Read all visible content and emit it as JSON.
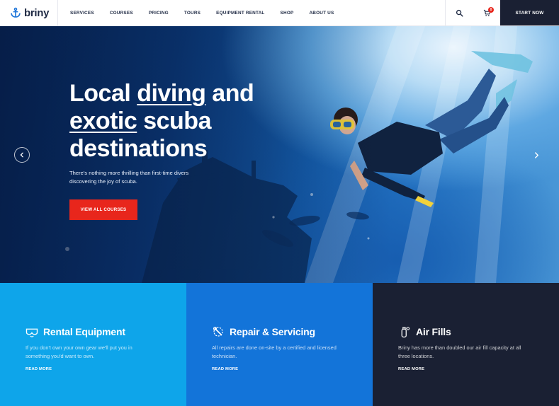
{
  "brand": {
    "name": "briny",
    "logo_icon": "anchor-icon"
  },
  "nav": {
    "items": [
      {
        "label": "SERVICES"
      },
      {
        "label": "COURSES"
      },
      {
        "label": "PRICING"
      },
      {
        "label": "TOURS"
      },
      {
        "label": "EQUIPMENT RENTAL"
      },
      {
        "label": "SHOP"
      },
      {
        "label": "ABOUT US"
      }
    ]
  },
  "header": {
    "search_icon": "search-icon",
    "cart_icon": "cart-icon",
    "cart_count": "0",
    "cta_label": "START NOW"
  },
  "hero": {
    "title_part1": "Local ",
    "title_highlight1": "diving",
    "title_part2": " and ",
    "title_highlight2": "exotic",
    "title_part3": " scuba destinations",
    "subtitle": "There's nothing more thrilling than first-time divers discovering the joy of scuba.",
    "button_label": "VIEW ALL COURSES",
    "prev_icon": "chevron-left-icon",
    "next_icon": "chevron-right-icon"
  },
  "features": [
    {
      "icon": "mask-icon",
      "title": "Rental Equipment",
      "text": "If you don't own your own gear we'll put you in something you'd want to own.",
      "link": "READ MORE",
      "color": "#0ea5ea"
    },
    {
      "icon": "wrench-icon",
      "title": "Repair & Servicing",
      "text": "All repairs are done on-site by a certified and licensed technician.",
      "link": "READ MORE",
      "color": "#1374d9"
    },
    {
      "icon": "air-tank-icon",
      "title": "Air Fills",
      "text": "Briny has more than doubled our air fill capacity at all three locations.",
      "link": "READ MORE",
      "color": "#1a2033"
    }
  ],
  "colors": {
    "accent_red": "#e8261c",
    "dark_navy": "#1a2033",
    "text_dark": "#1f2a44"
  }
}
